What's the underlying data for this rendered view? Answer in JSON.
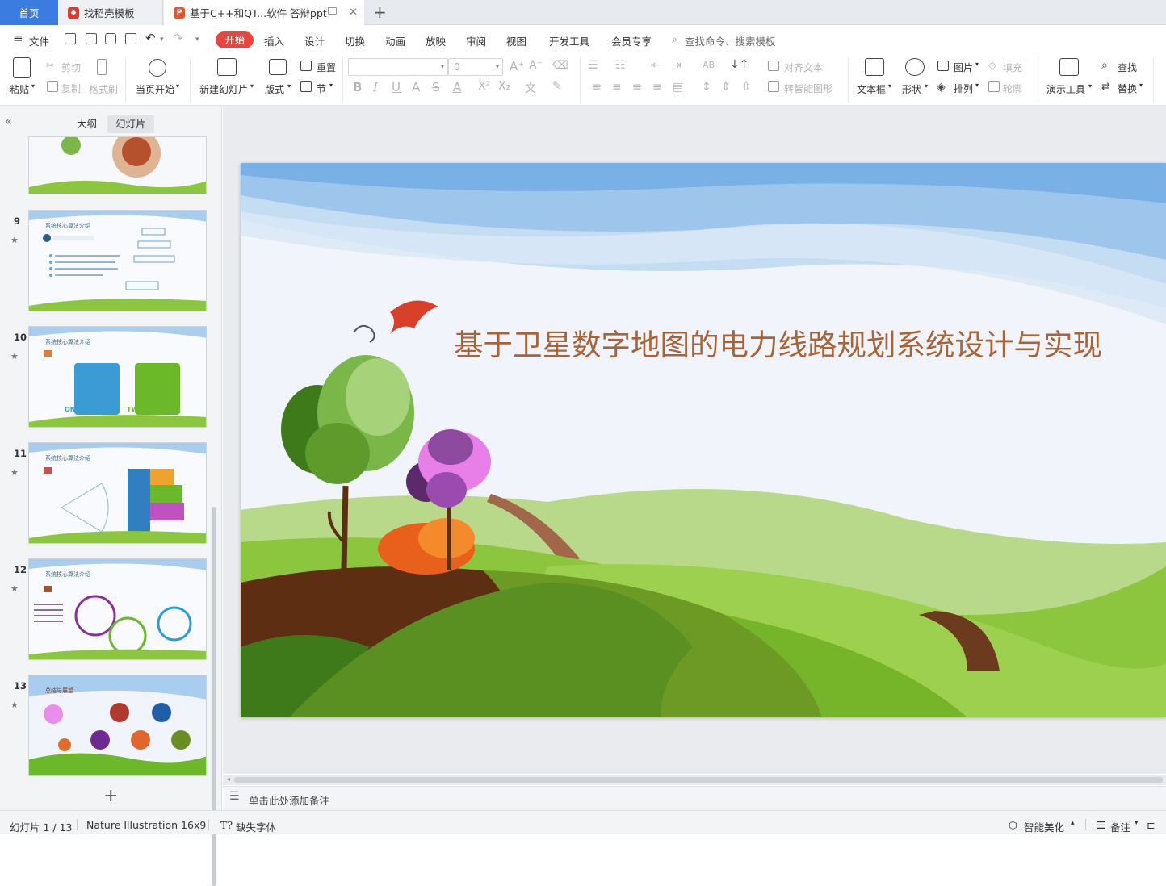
{
  "tabs": {
    "home": "首页",
    "template": "找稻壳模板",
    "document": "基于C++和QT...软件 答辩ppt"
  },
  "menu": {
    "file": "文件",
    "items": [
      "开始",
      "插入",
      "设计",
      "切换",
      "动画",
      "放映",
      "审阅",
      "视图",
      "开发工具",
      "会员专享"
    ],
    "search_placeholder": "查找命令、搜索模板"
  },
  "toolbar": {
    "paste": "粘贴",
    "cut": "剪切",
    "copy": "复制",
    "format_painter": "格式刷",
    "from_start": "当页开始",
    "new_slide": "新建幻灯片",
    "layout": "版式",
    "reset": "重置",
    "section": "节",
    "font_size": "0",
    "align_text": "对齐文本",
    "smart_art": "转智能图形",
    "textbox": "文本框",
    "shape": "形状",
    "picture": "图片",
    "arrange": "排列",
    "fill": "填充",
    "outline": "轮廓",
    "presenter_tools": "演示工具",
    "find": "查找",
    "replace": "替换"
  },
  "sidebar": {
    "tab_outline": "大纲",
    "tab_slides": "幻灯片",
    "slides": [
      {
        "num": "9",
        "title": "系统核心算法介绍"
      },
      {
        "num": "10",
        "title": "系统核心算法介绍",
        "labels": [
          "ONE",
          "TWO"
        ]
      },
      {
        "num": "11",
        "title": "系统核心算法介绍"
      },
      {
        "num": "12",
        "title": "系统核心算法介绍"
      },
      {
        "num": "13",
        "title": "总结与展望"
      }
    ]
  },
  "slide": {
    "title": "基于卫星数字地图的电力线路规划系统设计与实现"
  },
  "notes": {
    "placeholder": "单击此处添加备注"
  },
  "status": {
    "slide_counter": "幻灯片 1 / 13",
    "theme": "Nature Illustration 16x9",
    "missing_font": "缺失字体",
    "beautify": "智能美化",
    "notes": "备注"
  },
  "colors": {
    "accent": "#e8453c",
    "home_tab": "#3b7ce1",
    "title_text": "#a86336"
  }
}
